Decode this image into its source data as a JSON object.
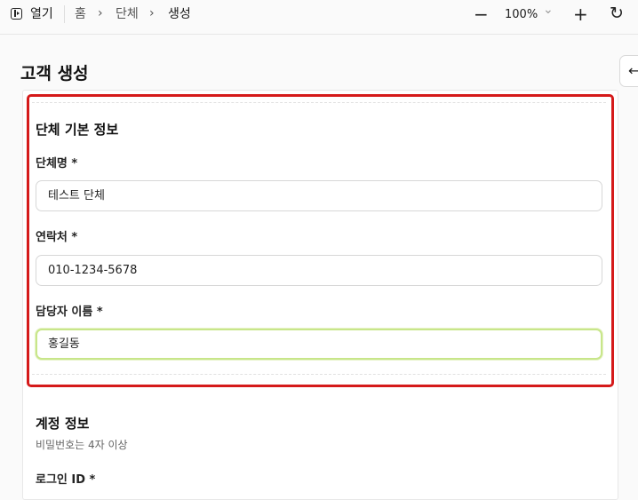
{
  "topbar": {
    "open_label": "열기",
    "breadcrumb": [
      "홈",
      "단체",
      "생성"
    ],
    "zoom": "100%",
    "zoom_out": "−",
    "zoom_in": "+",
    "refresh": "↻",
    "chevron": "›",
    "dropdown": "⌄"
  },
  "page": {
    "title": "고객 생성",
    "back_icon": "←"
  },
  "section_basic": {
    "title": "단체 기본 정보",
    "fields": [
      {
        "label": "단체명 *",
        "value": "테스트 단체"
      },
      {
        "label": "연락처 *",
        "value": "010-1234-5678"
      },
      {
        "label": "담당자 이름 *",
        "value": "홍길동"
      }
    ]
  },
  "section_account": {
    "title": "계정 정보",
    "description": "비밀번호는 4자 이상",
    "login_label": "로그인 ID *"
  },
  "colors": {
    "highlight_border": "#d51a1a",
    "focus_border": "#c8e68a"
  }
}
